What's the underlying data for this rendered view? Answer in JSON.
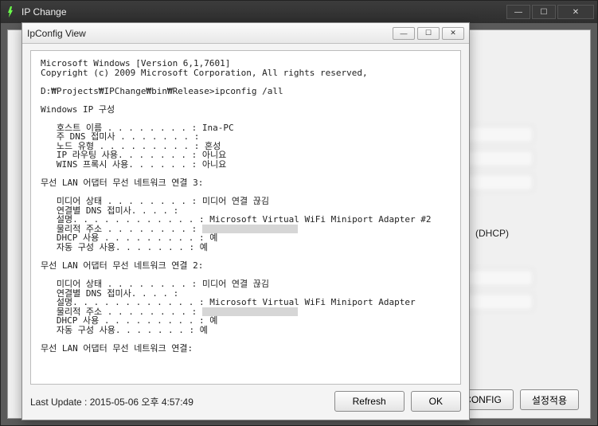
{
  "outer": {
    "title": "IP Change",
    "minimize": "—",
    "maximize": "☐",
    "close": "✕"
  },
  "bg": {
    "dhcp_label": "(DHCP)",
    "btn_config": "CONFIG",
    "btn_apply": "설정적용"
  },
  "modal": {
    "title": "IpConfig View",
    "minimize": "—",
    "maximize": "☐",
    "close": "✕",
    "footer_label": "Last Update : 2015-05-06 오후 4:57:49",
    "btn_refresh": "Refresh",
    "btn_ok": "OK",
    "lines": {
      "l1": "Microsoft Windows [Version 6,1,7601]",
      "l2": "Copyright (c) 2009 Microsoft Corporation, All rights reserved,",
      "l3": "D:₩Projects₩IPChange₩bin₩Release>ipconfig /all",
      "l4": "Windows IP 구성",
      "l5": "   호스트 이름 . . . . . . . . : Ina-PC",
      "l6": "   주 DNS 접미사 . . . . . . . :",
      "l7": "   노드 유형 . . . . . . . . . : 혼성",
      "l8": "   IP 라우팅 사용. . . . . . . : 아니요",
      "l9": "   WINS 프록시 사용. . . . . . : 아니요",
      "l10": "무선 LAN 어댑터 무선 네트워크 연결 3:",
      "l11": "   미디어 상태 . . . . . . . . : 미디어 연결 끊김",
      "l12": "   연결별 DNS 접미사. . . . :",
      "l13": "   설명. . . . . . . . . . . . : Microsoft Virtual WiFi Miniport Adapter #2",
      "l14a": "   물리적 주소 . . . . . . . . : ",
      "l15": "   DHCP 사용 . . . . . . . . . : 예",
      "l16": "   자동 구성 사용. . . . . . . : 예",
      "l17": "무선 LAN 어댑터 무선 네트워크 연결 2:",
      "l18": "   미디어 상태 . . . . . . . . : 미디어 연결 끊김",
      "l19": "   연결별 DNS 접미사. . . . :",
      "l20": "   설명. . . . . . . . . . . . : Microsoft Virtual WiFi Miniport Adapter",
      "l21a": "   물리적 주소 . . . . . . . . : ",
      "l22": "   DHCP 사용 . . . . . . . . . : 예",
      "l23": "   자동 구성 사용. . . . . . . : 예",
      "l24": "무선 LAN 어댑터 무선 네트워크 연결:"
    }
  }
}
